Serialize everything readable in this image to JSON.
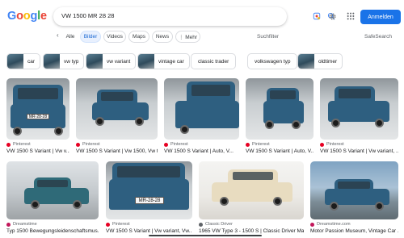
{
  "header": {
    "logo_letters": [
      "G",
      "o",
      "o",
      "g",
      "l",
      "e"
    ],
    "logo_colors": [
      "#4285f4",
      "#ea4335",
      "#fbbc05",
      "#4285f4",
      "#34a853",
      "#ea4335"
    ],
    "search_query": "VW 1500 MR 28 28",
    "signin_label": "Anmelden",
    "icons": [
      "close-icon",
      "lens-icon",
      "search-icon",
      "gear-icon",
      "apps-grid-icon"
    ],
    "accent_color": "#1a73e8"
  },
  "tabs": {
    "items": [
      {
        "label": "Alle"
      },
      {
        "label": "Bilder",
        "active": true
      },
      {
        "label": "Videos"
      },
      {
        "label": "Maps"
      },
      {
        "label": "News"
      },
      {
        "label": "⋮ Mehr"
      }
    ],
    "filters_label": "Suchfilter",
    "safesearch_label": "SafeSearch"
  },
  "chips": [
    {
      "label": "car",
      "thumb": true
    },
    {
      "label": "vw typ",
      "thumb": true
    },
    {
      "label": "vw variant",
      "thumb": true
    },
    {
      "label": "vintage car",
      "thumb": true
    },
    {
      "label": "classic trader",
      "thumb": false
    },
    {
      "label": "volkswagen typ",
      "thumb": false
    },
    {
      "label": "oldtimer",
      "thumb": true
    }
  ],
  "results": [
    {
      "source": "Pinterest",
      "source_color": "#e60023",
      "title": "VW 1500 S Variant | Vw v..."
    },
    {
      "source": "Pinterest",
      "source_color": "#e60023",
      "title": "VW 1500 S Variant | Vw 1500, Vw t..."
    },
    {
      "source": "Pinterest",
      "source_color": "#e60023",
      "title": "VW 1500 S Variant | Auto, V..."
    },
    {
      "source": "Pinterest",
      "source_color": "#e60023",
      "title": "VW 1500 S Variant | Vw variant, ..."
    },
    {
      "source": "Dreamstime",
      "source_color": "#c2185b",
      "title": "Typ 1500 Bewegungsleidenschaftsmus..."
    },
    {
      "source": "Pinterest",
      "source_color": "#e60023",
      "title": "VW 1500 S Variant | Vw variant, Vw..."
    },
    {
      "source": "Classic Driver",
      "source_color": "#5f6368",
      "title": "1965 VW Type 3 - 1500 S | Classic Driver Mar..."
    },
    {
      "source": "Dreamstime.com",
      "source_color": "#c2185b",
      "title": "Motor Passion Museum, Vintage Car ..."
    }
  ],
  "plates": [
    "MR-28-28",
    "MR-28-28"
  ],
  "colors": {
    "car_blue": "#2e5f80",
    "car_cream": "#e8dcc0",
    "car_teal": "#2f6a78"
  }
}
